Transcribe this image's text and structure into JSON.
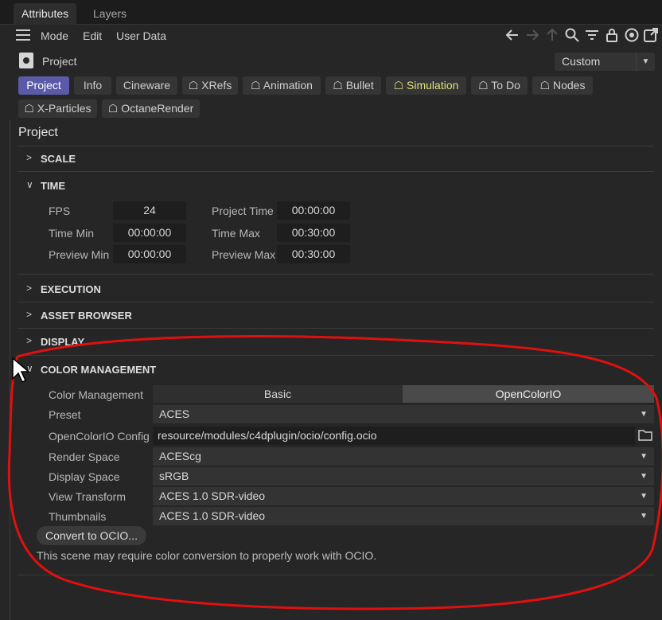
{
  "tabs": [
    "Attributes",
    "Layers"
  ],
  "menu": {
    "mode": "Mode",
    "edit": "Edit",
    "user_data": "User Data"
  },
  "object": {
    "label": "Project",
    "view_select": "Custom"
  },
  "pills_row1": [
    "Project",
    "Info",
    "Cineware",
    "XRefs",
    "Animation",
    "Bullet",
    "Simulation",
    "To Do",
    "Nodes"
  ],
  "pills_row2": [
    "X-Particles",
    "OctaneRender"
  ],
  "section_title": "Project",
  "groups": {
    "scale": "SCALE",
    "time": "TIME",
    "execution": "EXECUTION",
    "asset_browser": "ASSET BROWSER",
    "display": "DISPLAY",
    "color_management": "COLOR MANAGEMENT"
  },
  "time": {
    "fps_label": "FPS",
    "fps": "24",
    "project_time_label": "Project Time",
    "project_time": "00:00:00",
    "time_min_label": "Time Min",
    "time_min": "00:00:00",
    "time_max_label": "Time Max",
    "time_max": "00:30:00",
    "preview_min_label": "Preview Min",
    "preview_min": "00:00:00",
    "preview_max_label": "Preview Max",
    "preview_max": "00:30:00"
  },
  "color": {
    "cm_label": "Color Management",
    "cm_options": [
      "Basic",
      "OpenColorIO"
    ],
    "cm_selected": "OpenColorIO",
    "preset_label": "Preset",
    "preset": "ACES",
    "config_label": "OpenColorIO Config",
    "config": "resource/modules/c4dplugin/ocio/config.ocio",
    "render_label": "Render Space",
    "render": "ACEScg",
    "display_label": "Display Space",
    "display": "sRGB",
    "view_label": "View Transform",
    "view": "ACES 1.0 SDR-video",
    "thumb_label": "Thumbnails",
    "thumb": "ACES 1.0 SDR-video",
    "convert_button": "Convert to OCIO...",
    "note": "This scene may require color conversion to properly work with OCIO."
  },
  "colors": {
    "accent": "#5a5aa8",
    "annotation": "#e01010",
    "simulation_text": "#e0e07a"
  },
  "icons": [
    "menu-icon",
    "back-arrow-icon",
    "forward-arrow-icon",
    "up-arrow-icon",
    "search-icon",
    "filter-icon",
    "lock-icon",
    "target-icon",
    "open-window-icon",
    "project-gear-icon",
    "folder-icon",
    "cursor-icon"
  ]
}
